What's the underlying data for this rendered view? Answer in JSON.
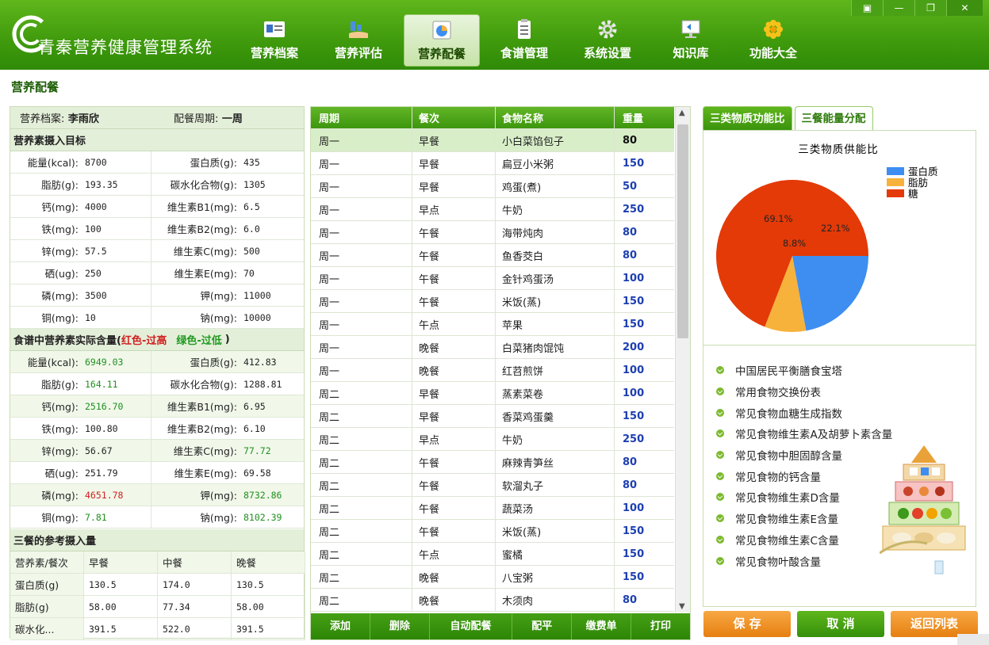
{
  "app": {
    "title": "青秦营养健康管理系统",
    "nav": [
      {
        "label": "营养档案",
        "icon": "id-card-icon"
      },
      {
        "label": "营养评估",
        "icon": "hand-chart-icon"
      },
      {
        "label": "营养配餐",
        "icon": "pie-chart-icon"
      },
      {
        "label": "食谱管理",
        "icon": "clipboard-icon"
      },
      {
        "label": "系统设置",
        "icon": "gear-icon"
      },
      {
        "label": "知识库",
        "icon": "monitor-icon"
      },
      {
        "label": "功能大全",
        "icon": "flower-icon"
      }
    ],
    "active_nav": "营养配餐",
    "window_buttons": [
      "restore-small-icon",
      "minimize-icon",
      "maximize-icon",
      "close-icon"
    ]
  },
  "page": {
    "heading": "营养配餐"
  },
  "profile": {
    "archive_label": "营养档案:",
    "archive_value": "李雨欣",
    "period_label": "配餐周期:",
    "period_value": "一周"
  },
  "target": {
    "heading": "营养素摄入目标",
    "rows": [
      [
        {
          "label": "能量(kcal):",
          "value": "8700"
        },
        {
          "label": "蛋白质(g):",
          "value": "435"
        }
      ],
      [
        {
          "label": "脂肪(g):",
          "value": "193.35"
        },
        {
          "label": "碳水化合物(g):",
          "value": "1305"
        }
      ],
      [
        {
          "label": "钙(mg):",
          "value": "4000"
        },
        {
          "label": "维生素B1(mg):",
          "value": "6.5"
        }
      ],
      [
        {
          "label": "铁(mg):",
          "value": "100"
        },
        {
          "label": "维生素B2(mg):",
          "value": "6.0"
        }
      ],
      [
        {
          "label": "锌(mg):",
          "value": "57.5"
        },
        {
          "label": "维生素C(mg):",
          "value": "500"
        }
      ],
      [
        {
          "label": "硒(ug):",
          "value": "250"
        },
        {
          "label": "维生素E(mg):",
          "value": "70"
        }
      ],
      [
        {
          "label": "磷(mg):",
          "value": "3500"
        },
        {
          "label": "钾(mg):",
          "value": "11000"
        }
      ],
      [
        {
          "label": "铜(mg):",
          "value": "10"
        },
        {
          "label": "钠(mg):",
          "value": "10000"
        }
      ]
    ]
  },
  "actual": {
    "heading_main": "食谱中营养素实际含量(",
    "legend_red": "红色-过高",
    "legend_green": "绿色-过低",
    "heading_close": ")",
    "rows": [
      [
        {
          "label": "能量(kcal):",
          "value": "6949.03",
          "status": "low"
        },
        {
          "label": "蛋白质(g):",
          "value": "412.83",
          "status": "normal"
        }
      ],
      [
        {
          "label": "脂肪(g):",
          "value": "164.11",
          "status": "low"
        },
        {
          "label": "碳水化合物(g):",
          "value": "1288.81",
          "status": "normal"
        }
      ],
      [
        {
          "label": "钙(mg):",
          "value": "2516.70",
          "status": "low"
        },
        {
          "label": "维生素B1(mg):",
          "value": "6.95",
          "status": "normal"
        }
      ],
      [
        {
          "label": "铁(mg):",
          "value": "100.80",
          "status": "normal"
        },
        {
          "label": "维生素B2(mg):",
          "value": "6.10",
          "status": "normal"
        }
      ],
      [
        {
          "label": "锌(mg):",
          "value": "56.67",
          "status": "normal"
        },
        {
          "label": "维生素C(mg):",
          "value": "77.72",
          "status": "low"
        }
      ],
      [
        {
          "label": "硒(ug):",
          "value": "251.79",
          "status": "normal"
        },
        {
          "label": "维生素E(mg):",
          "value": "69.58",
          "status": "normal"
        }
      ],
      [
        {
          "label": "磷(mg):",
          "value": "4651.78",
          "status": "high"
        },
        {
          "label": "钾(mg):",
          "value": "8732.86",
          "status": "low"
        }
      ],
      [
        {
          "label": "铜(mg):",
          "value": "7.81",
          "status": "low"
        },
        {
          "label": "钠(mg):",
          "value": "8102.39",
          "status": "low"
        }
      ]
    ]
  },
  "reference": {
    "heading": "三餐的参考摄入量",
    "columns": [
      "营养素/餐次",
      "早餐",
      "中餐",
      "晚餐"
    ],
    "rows": [
      [
        "蛋白质(g)",
        "130.5",
        "174.0",
        "130.5"
      ],
      [
        "脂肪(g)",
        "58.00",
        "77.34",
        "58.00"
      ],
      [
        "碳水化...",
        "391.5",
        "522.0",
        "391.5"
      ]
    ]
  },
  "menu": {
    "columns": [
      "周期",
      "餐次",
      "食物名称",
      "重量"
    ],
    "rows": [
      [
        "周一",
        "早餐",
        "小白菜馅包子",
        "80"
      ],
      [
        "周一",
        "早餐",
        "扁豆小米粥",
        "150"
      ],
      [
        "周一",
        "早餐",
        "鸡蛋(煮)",
        "50"
      ],
      [
        "周一",
        "早点",
        "牛奶",
        "250"
      ],
      [
        "周一",
        "午餐",
        "海带炖肉",
        "80"
      ],
      [
        "周一",
        "午餐",
        "鱼香茭白",
        "80"
      ],
      [
        "周一",
        "午餐",
        "金针鸡蛋汤",
        "100"
      ],
      [
        "周一",
        "午餐",
        "米饭(蒸)",
        "150"
      ],
      [
        "周一",
        "午点",
        "苹果",
        "150"
      ],
      [
        "周一",
        "晚餐",
        "白菜猪肉馄饨",
        "200"
      ],
      [
        "周一",
        "晚餐",
        "红苕煎饼",
        "100"
      ],
      [
        "周二",
        "早餐",
        "蒸素菜卷",
        "100"
      ],
      [
        "周二",
        "早餐",
        "香菜鸡蛋羹",
        "150"
      ],
      [
        "周二",
        "早点",
        "牛奶",
        "250"
      ],
      [
        "周二",
        "午餐",
        "麻辣青笋丝",
        "80"
      ],
      [
        "周二",
        "午餐",
        "软溜丸子",
        "80"
      ],
      [
        "周二",
        "午餐",
        "蔬菜汤",
        "100"
      ],
      [
        "周二",
        "午餐",
        "米饭(蒸)",
        "150"
      ],
      [
        "周二",
        "午点",
        "蜜橘",
        "150"
      ],
      [
        "周二",
        "晚餐",
        "八宝粥",
        "150"
      ],
      [
        "周二",
        "晚餐",
        "木须肉",
        "80"
      ]
    ],
    "selected_row": 0,
    "toolbar": [
      "添加",
      "删除",
      "自动配餐",
      "配平",
      "缴费单",
      "打印"
    ]
  },
  "chart_tabs": [
    "三类物质功能比",
    "三餐能量分配"
  ],
  "chart_data": {
    "type": "pie",
    "title": "三类物质供能比",
    "slices": [
      {
        "name": "蛋白质",
        "value": 22.1,
        "label": "22.1%",
        "color": "#3d8ef0"
      },
      {
        "name": "脂肪",
        "value": 8.8,
        "label": "8.8%",
        "color": "#f7b23b"
      },
      {
        "name": "糖",
        "value": 69.1,
        "label": "69.1%",
        "color": "#e33a07"
      }
    ],
    "legend_position": "top-right"
  },
  "knowledge_links": [
    "中国居民平衡膳食宝塔",
    "常用食物交换份表",
    "常见食物血糖生成指数",
    "常见食物维生素A及胡萝卜素含量",
    "常见食物中胆固醇含量",
    "常见食物的钙含量",
    "常见食物维生素D含量",
    "常见食物维生素E含量",
    "常见食物维生素C含量",
    "常见食物叶酸含量"
  ],
  "actions": {
    "save": "保 存",
    "cancel": "取 消",
    "back": "返回列表"
  },
  "colors": {
    "brand_green": "#3f9a0c",
    "high": "#d12020",
    "low": "#1f8f1f",
    "save_orange": "#f08a1c",
    "cancel_green": "#45a015"
  }
}
